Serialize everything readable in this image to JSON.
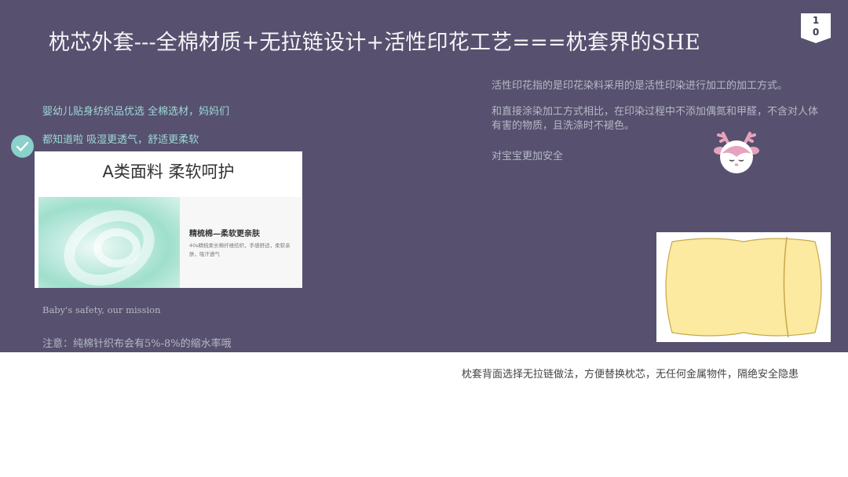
{
  "slide": {
    "title": "枕芯外套---全棉材质+无拉链设计+活性印花工艺===枕套界的SHE",
    "page_number_digit1": "1",
    "page_number_digit2": "0"
  },
  "left": {
    "line1": "婴幼儿贴身纺织品优选 全棉选材，妈妈们",
    "line2": "都知道啦 吸湿更透气，舒适更柔软",
    "english": "Baby's safety, our mission",
    "note": "注意：纯棉针织布会有5%-8%的缩水率哦"
  },
  "product_card": {
    "title": "A类面料 柔软呵护",
    "subtitle": "精梳棉—柔软更亲肤",
    "description": "40s精梳柔长棉纤维纺织，手感舒适，柔软亲肤，吸汗透气"
  },
  "right": {
    "para1": "活性印花指的是印花染料采用的是活性印染进行加工的加工方式。",
    "para2": "和直接涂染加工方式相比，在印染过程中不添加偶氮和甲醛，不含对人体有害的物质，且洗涤时不褪色。",
    "para3": "对宝宝更加安全"
  },
  "bottom": {
    "text": "枕套背面选择无拉链做法，方便替换枕芯，无任何金属物件，隔绝安全隐患"
  },
  "colors": {
    "panel": "#57506f",
    "accent": "#8ad0cb",
    "text_muted": "#b5b9c4",
    "pillow_fill": "#fbeaa0",
    "deer_pink": "#e6a3bd"
  },
  "icons": {
    "check": "check-circle-icon",
    "deer": "deer-mascot-icon"
  }
}
